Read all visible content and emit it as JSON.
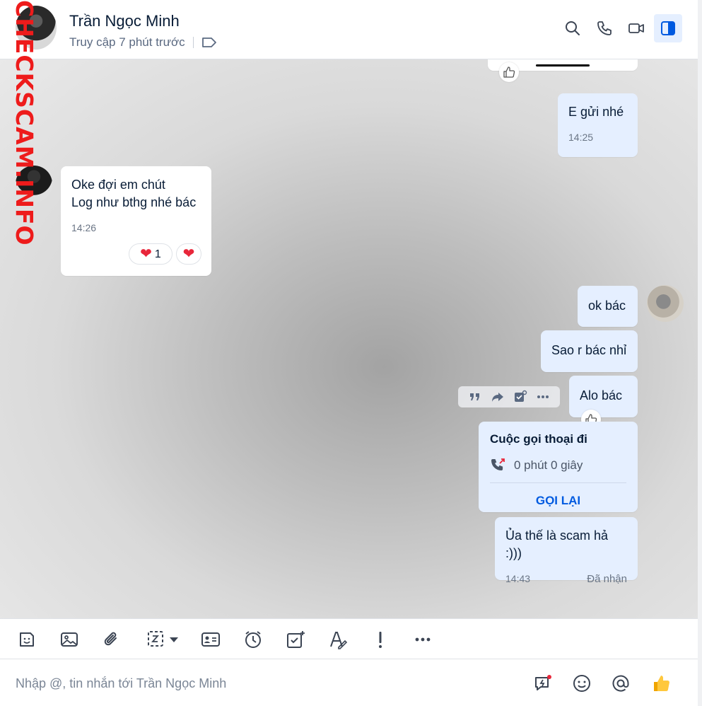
{
  "watermark": {
    "text": "CHECKSCAM.INFO"
  },
  "header": {
    "contact_name": "Trần Ngọc Minh",
    "last_seen": "Truy cập 7 phút trước",
    "icons": [
      "search-icon",
      "phone-icon",
      "video-icon",
      "sidebar-toggle-icon"
    ]
  },
  "messages": [
    {
      "id": "m1",
      "side": "mine",
      "text": "E gửi nhé",
      "time": "14:25"
    },
    {
      "id": "m2",
      "side": "theirs",
      "lines": [
        "Oke đợi em chút",
        "Log như bthg nhé bác"
      ],
      "time": "14:26",
      "reaction_count": "1"
    },
    {
      "id": "m3",
      "side": "mine",
      "text": "ok bác"
    },
    {
      "id": "m4",
      "side": "mine",
      "text": "Sao r bác nhỉ"
    },
    {
      "id": "m5",
      "side": "mine",
      "text": "Alo bác"
    },
    {
      "id": "m6",
      "side": "mine",
      "type": "call",
      "title": "Cuộc gọi thoại đi",
      "duration": "0 phút 0 giây",
      "action": "GỌI LẠI"
    },
    {
      "id": "m7",
      "side": "mine",
      "text": "Ủa thế là scam hả :)))",
      "time": "14:43",
      "status": "Đã nhận"
    }
  ],
  "toolbar": {
    "icons": [
      "sticker-icon",
      "image-icon",
      "attachment-icon",
      "screenshot-icon",
      "contact-card-icon",
      "reminder-icon",
      "task-icon",
      "text-format-icon",
      "important-icon",
      "more-icon"
    ]
  },
  "composer": {
    "placeholder": "Nhập @, tin nhắn tới Trần Ngọc Minh",
    "icons": [
      "quick-message-icon",
      "emoji-icon",
      "mention-icon",
      "thumbs-up-icon"
    ]
  },
  "colors": {
    "accent": "#005ae0",
    "my_bubble": "#e5efff",
    "their_bubble": "#ffffff",
    "heart": "#e8263a",
    "watermark": "#ee1b1b"
  }
}
